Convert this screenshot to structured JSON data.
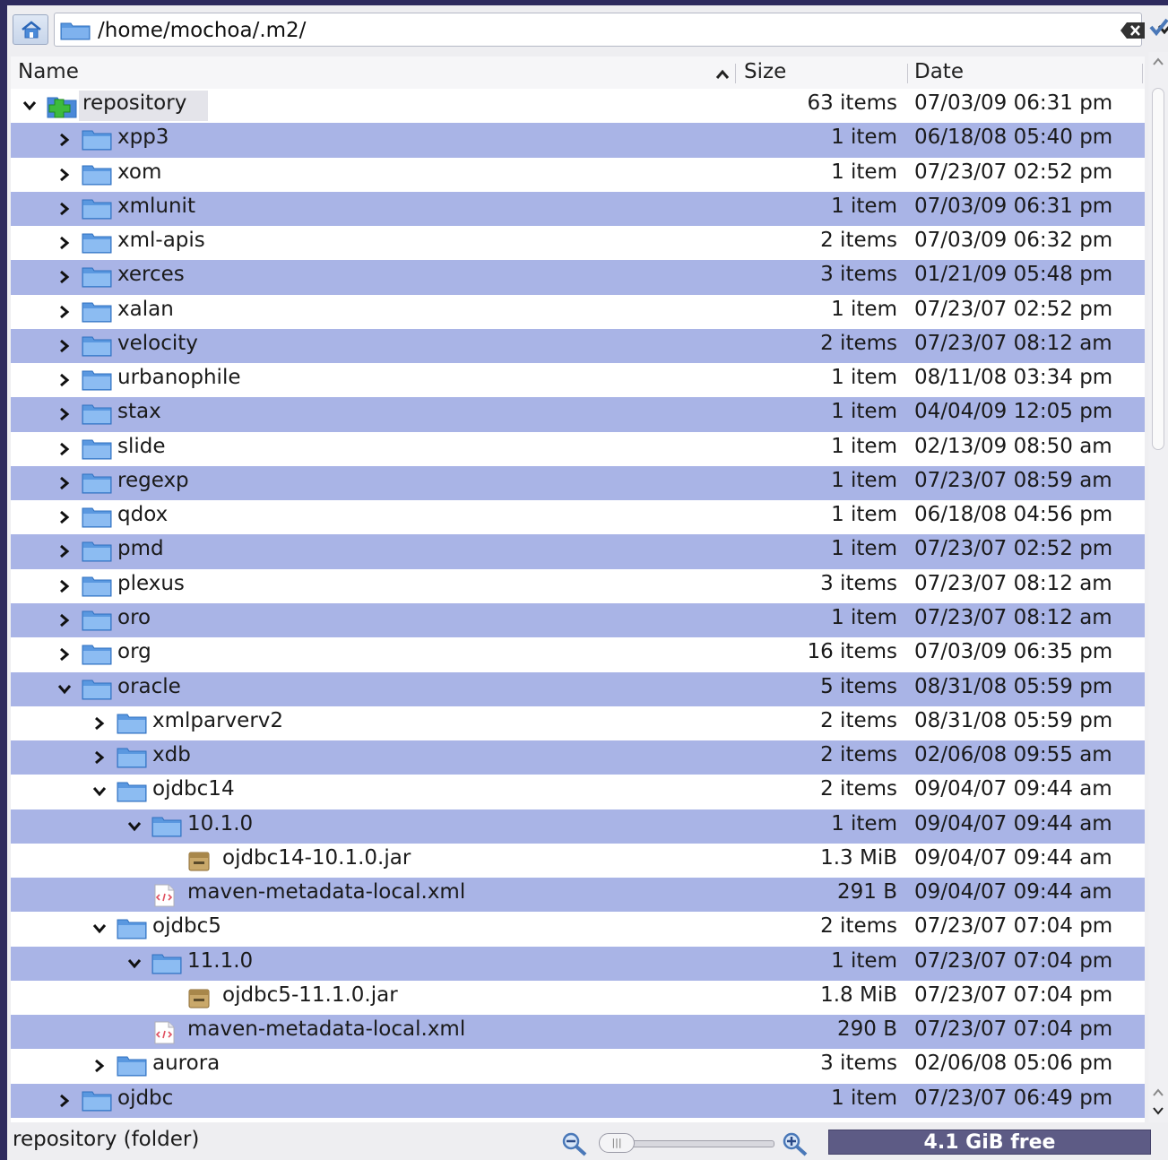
{
  "location": {
    "path": "/home/mochoa/.m2/",
    "home_icon": "home-icon",
    "folder_icon": "folder-icon",
    "clear_icon": "clear-text-icon",
    "dropdown_icon": "chevron-down-icon",
    "go_icon": "checkmark-icon"
  },
  "columns": {
    "name": "Name",
    "size": "Size",
    "date": "Date"
  },
  "rows": [
    {
      "name": "repository",
      "size": "63 items",
      "date": "07/03/09 06:31 pm",
      "depth": 0,
      "expanded": true,
      "type": "special",
      "selected": true
    },
    {
      "name": "xpp3",
      "size": "1 item",
      "date": "06/18/08 05:40 pm",
      "depth": 1,
      "expanded": false,
      "type": "folder"
    },
    {
      "name": "xom",
      "size": "1 item",
      "date": "07/23/07 02:52 pm",
      "depth": 1,
      "expanded": false,
      "type": "folder"
    },
    {
      "name": "xmlunit",
      "size": "1 item",
      "date": "07/03/09 06:31 pm",
      "depth": 1,
      "expanded": false,
      "type": "folder"
    },
    {
      "name": "xml-apis",
      "size": "2 items",
      "date": "07/03/09 06:32 pm",
      "depth": 1,
      "expanded": false,
      "type": "folder"
    },
    {
      "name": "xerces",
      "size": "3 items",
      "date": "01/21/09 05:48 pm",
      "depth": 1,
      "expanded": false,
      "type": "folder"
    },
    {
      "name": "xalan",
      "size": "1 item",
      "date": "07/23/07 02:52 pm",
      "depth": 1,
      "expanded": false,
      "type": "folder"
    },
    {
      "name": "velocity",
      "size": "2 items",
      "date": "07/23/07 08:12 am",
      "depth": 1,
      "expanded": false,
      "type": "folder"
    },
    {
      "name": "urbanophile",
      "size": "1 item",
      "date": "08/11/08 03:34 pm",
      "depth": 1,
      "expanded": false,
      "type": "folder"
    },
    {
      "name": "stax",
      "size": "1 item",
      "date": "04/04/09 12:05 pm",
      "depth": 1,
      "expanded": false,
      "type": "folder"
    },
    {
      "name": "slide",
      "size": "1 item",
      "date": "02/13/09 08:50 am",
      "depth": 1,
      "expanded": false,
      "type": "folder"
    },
    {
      "name": "regexp",
      "size": "1 item",
      "date": "07/23/07 08:59 am",
      "depth": 1,
      "expanded": false,
      "type": "folder"
    },
    {
      "name": "qdox",
      "size": "1 item",
      "date": "06/18/08 04:56 pm",
      "depth": 1,
      "expanded": false,
      "type": "folder"
    },
    {
      "name": "pmd",
      "size": "1 item",
      "date": "07/23/07 02:52 pm",
      "depth": 1,
      "expanded": false,
      "type": "folder"
    },
    {
      "name": "plexus",
      "size": "3 items",
      "date": "07/23/07 08:12 am",
      "depth": 1,
      "expanded": false,
      "type": "folder"
    },
    {
      "name": "oro",
      "size": "1 item",
      "date": "07/23/07 08:12 am",
      "depth": 1,
      "expanded": false,
      "type": "folder"
    },
    {
      "name": "org",
      "size": "16 items",
      "date": "07/03/09 06:35 pm",
      "depth": 1,
      "expanded": false,
      "type": "folder"
    },
    {
      "name": "oracle",
      "size": "5 items",
      "date": "08/31/08 05:59 pm",
      "depth": 1,
      "expanded": true,
      "type": "folder"
    },
    {
      "name": "xmlparverv2",
      "size": "2 items",
      "date": "08/31/08 05:59 pm",
      "depth": 2,
      "expanded": false,
      "type": "folder"
    },
    {
      "name": "xdb",
      "size": "2 items",
      "date": "02/06/08 09:55 am",
      "depth": 2,
      "expanded": false,
      "type": "folder"
    },
    {
      "name": "ojdbc14",
      "size": "2 items",
      "date": "09/04/07 09:44 am",
      "depth": 2,
      "expanded": true,
      "type": "folder"
    },
    {
      "name": "10.1.0",
      "size": "1 item",
      "date": "09/04/07 09:44 am",
      "depth": 3,
      "expanded": true,
      "type": "folder"
    },
    {
      "name": "ojdbc14-10.1.0.jar",
      "size": "1.3 MiB",
      "date": "09/04/07 09:44 am",
      "depth": 4,
      "expanded": null,
      "type": "jar"
    },
    {
      "name": "maven-metadata-local.xml",
      "size": "291 B",
      "date": "09/04/07 09:44 am",
      "depth": 3,
      "expanded": null,
      "type": "xml"
    },
    {
      "name": "ojdbc5",
      "size": "2 items",
      "date": "07/23/07 07:04 pm",
      "depth": 2,
      "expanded": true,
      "type": "folder"
    },
    {
      "name": "11.1.0",
      "size": "1 item",
      "date": "07/23/07 07:04 pm",
      "depth": 3,
      "expanded": true,
      "type": "folder"
    },
    {
      "name": "ojdbc5-11.1.0.jar",
      "size": "1.8 MiB",
      "date": "07/23/07 07:04 pm",
      "depth": 4,
      "expanded": null,
      "type": "jar"
    },
    {
      "name": "maven-metadata-local.xml",
      "size": "290 B",
      "date": "07/23/07 07:04 pm",
      "depth": 3,
      "expanded": null,
      "type": "xml"
    },
    {
      "name": "aurora",
      "size": "3 items",
      "date": "02/06/08 05:06 pm",
      "depth": 2,
      "expanded": false,
      "type": "folder"
    },
    {
      "name": "ojdbc",
      "size": "1 item",
      "date": "07/23/07 06:49 pm",
      "depth": 1,
      "expanded": false,
      "type": "folder"
    }
  ],
  "status": {
    "text": "repository (folder)",
    "free_space": "4.1 GiB free",
    "zoom_out_icon": "zoom-out-icon",
    "zoom_in_icon": "zoom-in-icon"
  },
  "colors": {
    "alt_row": "#a9b4e6",
    "background": "#2e2b5e",
    "free_bar": "#5d5b85"
  }
}
